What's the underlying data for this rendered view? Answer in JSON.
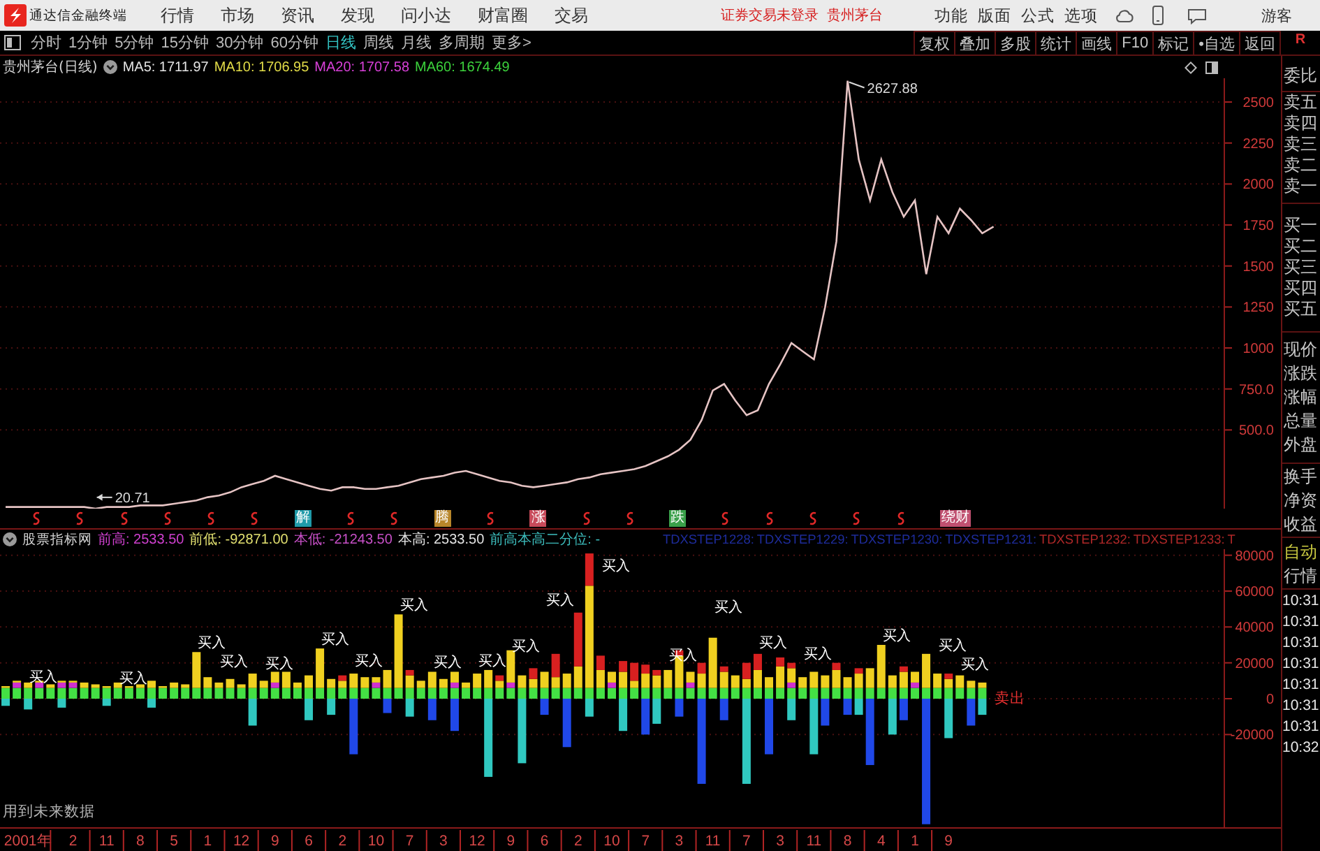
{
  "title_bar": {
    "app_name": "通达信金融终端",
    "menu": [
      "行情",
      "市场",
      "资讯",
      "发现",
      "问小达",
      "财富圈",
      "交易"
    ],
    "status": "证券交易未登录",
    "stock": "贵州茅台",
    "tools": [
      "功能",
      "版面",
      "公式",
      "选项"
    ],
    "user": "游客"
  },
  "toolbar": {
    "periods": [
      {
        "label": "分时",
        "selected": false
      },
      {
        "label": "1分钟",
        "selected": false
      },
      {
        "label": "5分钟",
        "selected": false
      },
      {
        "label": "15分钟",
        "selected": false
      },
      {
        "label": "30分钟",
        "selected": false
      },
      {
        "label": "60分钟",
        "selected": false
      },
      {
        "label": "日线",
        "selected": true
      },
      {
        "label": "周线",
        "selected": false
      },
      {
        "label": "月线",
        "selected": false
      },
      {
        "label": "多周期",
        "selected": false
      },
      {
        "label": "更多>",
        "selected": false
      }
    ],
    "actions": [
      "复权",
      "叠加",
      "多股",
      "统计",
      "画线",
      "F10",
      "标记",
      "•自选",
      "返回"
    ],
    "corner": "R"
  },
  "price_panel": {
    "title": "贵州茅台(日线)",
    "ma": [
      {
        "text": "MA5: 1711.97",
        "color": "#e4e4e4"
      },
      {
        "text": "MA10: 1706.95",
        "color": "#e2dc48"
      },
      {
        "text": "MA20: 1707.58",
        "color": "#d840d8"
      },
      {
        "text": "MA60: 1674.49",
        "color": "#3cd23c"
      }
    ],
    "chart_data": {
      "type": "line",
      "series": [
        {
          "color": "#e6c4c4",
          "values": [
            30,
            30,
            30,
            30,
            30,
            30,
            30,
            30,
            20,
            30,
            30,
            30,
            40,
            40,
            40,
            50,
            60,
            70,
            90,
            100,
            120,
            150,
            170,
            190,
            220,
            200,
            180,
            160,
            140,
            130,
            150,
            150,
            140,
            140,
            150,
            160,
            180,
            200,
            210,
            220,
            240,
            250,
            230,
            210,
            190,
            180,
            160,
            150,
            160,
            170,
            180,
            200,
            210,
            230,
            240,
            250,
            260,
            280,
            310,
            340,
            380,
            440,
            560,
            740,
            780,
            680,
            590,
            620,
            780,
            900,
            1030,
            980,
            930,
            1250,
            1650,
            2630,
            2150,
            1900,
            2150,
            1950,
            1800,
            1900,
            1450,
            1800,
            1700,
            1850,
            1780,
            1700,
            1740
          ]
        }
      ],
      "ylim": [
        20,
        2645
      ],
      "grid": true,
      "yticks": [
        {
          "value": 2500,
          "label": "2500"
        },
        {
          "value": 2250,
          "label": "2250"
        },
        {
          "value": 2000,
          "label": "2000"
        },
        {
          "value": 1750,
          "label": "1750"
        },
        {
          "value": 1500,
          "label": "1500"
        },
        {
          "value": 1250,
          "label": "1250"
        },
        {
          "value": 1000,
          "label": "1000"
        },
        {
          "value": 750,
          "label": "750.0"
        },
        {
          "value": 500,
          "label": "500.0"
        }
      ],
      "annotations": [
        "2627.88",
        {
          "text": "20.71",
          "y": 20.71
        }
      ]
    },
    "event_markers": [
      {
        "kind": "mark"
      },
      {
        "kind": "mark"
      },
      {
        "kind": "mark"
      },
      {
        "kind": "mark"
      },
      {
        "kind": "mark"
      },
      {
        "kind": "mark"
      },
      {
        "kind": "tag",
        "text": "解",
        "color": "#1f9aa8"
      },
      {
        "kind": "mark"
      },
      {
        "kind": "mark"
      },
      {
        "kind": "tag",
        "text": "腾",
        "color": "#b8862a"
      },
      {
        "kind": "mark"
      },
      {
        "kind": "tag",
        "text": "涨",
        "color": "#c84a5a"
      },
      {
        "kind": "mark"
      },
      {
        "kind": "mark"
      },
      {
        "kind": "tag",
        "text": "跌",
        "color": "#3aa04a"
      },
      {
        "kind": "mark"
      },
      {
        "kind": "mark"
      },
      {
        "kind": "mark"
      },
      {
        "kind": "mark"
      },
      {
        "kind": "mark"
      },
      {
        "kind": "tag",
        "text": "绕财",
        "color": "#c05070"
      }
    ]
  },
  "indicator_panel": {
    "title": "股票指标网",
    "values": [
      {
        "text": "前高: 2533.50",
        "color": "#d040d0"
      },
      {
        "text": "前低: -92871.00",
        "color": "#e2e070"
      },
      {
        "text": "本低: -21243.50",
        "color": "#c850c8"
      },
      {
        "text": "本高: 2533.50",
        "color": "#e4e4e4"
      },
      {
        "text": "前高本高二分位: -",
        "color": "#3cbcbc"
      }
    ],
    "steps": [
      {
        "text": "TDXSTEP1228:",
        "color": "#1e2c9c"
      },
      {
        "text": "TDXSTEP1229:",
        "color": "#1e2c9c"
      },
      {
        "text": "TDXSTEP1230:",
        "color": "#1e2c9c"
      },
      {
        "text": "TDXSTEP1231:",
        "color": "#1e2c9c"
      },
      {
        "text": "TDXSTEP1232:",
        "color": "#b02828"
      },
      {
        "text": "TDXSTEP1233:",
        "color": "#b02828"
      },
      {
        "text": "T",
        "color": "#b02828"
      }
    ],
    "chart_data": {
      "type": "bar",
      "stacked": true,
      "grid": true,
      "categories": [
        null,
        null,
        "2001年",
        null,
        null,
        null,
        "2",
        null,
        null,
        "11",
        null,
        null,
        "8",
        null,
        null,
        "5",
        null,
        null,
        "1",
        null,
        null,
        "12",
        null,
        null,
        "9",
        null,
        null,
        "6",
        null,
        null,
        "2",
        null,
        null,
        "10",
        null,
        null,
        "7",
        null,
        null,
        "3",
        null,
        null,
        "12",
        null,
        null,
        "9",
        null,
        null,
        "6",
        null,
        null,
        "2",
        null,
        null,
        "10",
        null,
        null,
        "7",
        null,
        null,
        "3",
        null,
        null,
        "11",
        null,
        null,
        "7",
        null,
        null,
        "3",
        null,
        null,
        "11",
        null,
        null,
        "8",
        null,
        null,
        "4",
        null,
        null,
        "1",
        null,
        null,
        "9",
        null,
        null,
        null,
        null,
        null,
        null,
        null,
        null,
        null,
        null,
        null,
        null,
        null,
        null,
        null,
        null,
        null,
        null,
        null,
        null,
        null,
        null,
        null,
        null
      ],
      "ylim": [
        -71690,
        83380
      ],
      "yticks": [
        {
          "value": 80000,
          "label": "80000"
        },
        {
          "value": 60000,
          "label": "60000"
        },
        {
          "value": 40000,
          "label": "40000"
        },
        {
          "value": 20000,
          "label": "20000"
        },
        {
          "value": 0,
          "label": "0"
        },
        {
          "value": -20000,
          "label": "-20000"
        }
      ],
      "series": [
        {
          "color": "#44e044",
          "values": [
            6000,
            6000,
            6000,
            6000,
            6000,
            6000,
            6000,
            6000,
            6000,
            6000,
            6000,
            6000,
            6000,
            6000,
            6000,
            6000,
            6000,
            6000,
            6000,
            6000,
            6000,
            6000,
            6000,
            6000,
            6000,
            6000,
            6000,
            6000,
            6000,
            6000,
            6000,
            6000,
            6000,
            6000,
            6000,
            6000,
            6000,
            6000,
            6000,
            6000,
            6000,
            6000,
            6000,
            6000,
            6000,
            6000,
            6000,
            6000,
            6000,
            6000,
            6000,
            6000,
            6000,
            6000,
            6000,
            6000,
            6000,
            6000,
            6000,
            6000,
            6000,
            6000,
            6000,
            6000,
            6000,
            6000,
            6000,
            6000,
            6000,
            6000,
            6000,
            6000,
            6000,
            6000,
            6000,
            6000,
            6000,
            6000,
            6000,
            6000,
            6000,
            6000,
            6000,
            6000,
            6000,
            6000,
            6000,
            6000,
            null,
            null,
            null,
            null,
            null,
            null,
            null,
            null,
            null,
            null,
            null,
            null,
            null,
            null,
            null,
            null,
            null,
            null,
            null,
            null,
            null
          ]
        },
        {
          "color": "#d030d0",
          "values": [
            null,
            3000,
            null,
            3000,
            null,
            3000,
            3000,
            null,
            null,
            null,
            null,
            null,
            null,
            null,
            null,
            null,
            null,
            null,
            null,
            null,
            null,
            null,
            null,
            null,
            3000,
            null,
            null,
            null,
            null,
            null,
            null,
            null,
            null,
            3000,
            null,
            null,
            null,
            null,
            null,
            null,
            3000,
            null,
            null,
            null,
            null,
            3000,
            null,
            null,
            null,
            null,
            null,
            null,
            null,
            null,
            3000,
            null,
            null,
            null,
            null,
            null,
            null,
            3000,
            null,
            null,
            null,
            null,
            null,
            null,
            null,
            null,
            3000,
            null,
            null,
            null,
            null,
            null,
            null,
            null,
            null,
            null,
            null,
            3000,
            null,
            null,
            null,
            null,
            null,
            null,
            null,
            null,
            null,
            null,
            null,
            null,
            null,
            null,
            null,
            null,
            null,
            null,
            null,
            null,
            null,
            null,
            null,
            null,
            null,
            null,
            null
          ]
        },
        {
          "color": "#f0d020",
          "values": [
            1000,
            1000,
            3000,
            1000,
            2000,
            1000,
            1000,
            3000,
            2000,
            1000,
            3000,
            1000,
            2000,
            4000,
            1000,
            3000,
            2000,
            20000,
            6000,
            3000,
            5000,
            2000,
            8000,
            4000,
            6000,
            9000,
            3000,
            7000,
            22000,
            5000,
            4000,
            8000,
            6000,
            3000,
            10000,
            41000,
            7000,
            4000,
            9000,
            5000,
            6000,
            3000,
            8000,
            10000,
            4000,
            18000,
            7000,
            5000,
            9000,
            6000,
            8000,
            12000,
            57000,
            10000,
            6000,
            9000,
            4000,
            8000,
            7000,
            10000,
            18000,
            6000,
            8000,
            28000,
            9000,
            7000,
            5000,
            10000,
            6000,
            12000,
            8000,
            6000,
            9000,
            7000,
            10000,
            6000,
            8000,
            11000,
            24000,
            7000,
            9000,
            6000,
            19000,
            8000,
            5000,
            7000,
            4000,
            3000,
            null,
            null,
            null,
            null,
            null,
            null,
            null,
            null,
            null,
            null,
            null,
            null,
            null,
            null,
            null,
            null,
            null,
            null,
            null,
            null,
            null
          ]
        },
        {
          "color": "#d82020",
          "values": [
            null,
            null,
            null,
            null,
            null,
            null,
            null,
            null,
            null,
            null,
            null,
            null,
            null,
            null,
            null,
            null,
            null,
            null,
            null,
            null,
            null,
            null,
            null,
            null,
            null,
            null,
            null,
            null,
            null,
            null,
            3000,
            null,
            null,
            null,
            null,
            null,
            3000,
            null,
            null,
            null,
            null,
            null,
            null,
            null,
            3000,
            null,
            null,
            6000,
            null,
            13000,
            null,
            30000,
            18000,
            8000,
            null,
            6000,
            10000,
            5000,
            3000,
            null,
            3000,
            null,
            6000,
            null,
            3000,
            null,
            9000,
            9000,
            null,
            5000,
            3000,
            null,
            null,
            null,
            4000,
            null,
            3000,
            null,
            null,
            null,
            3000,
            null,
            null,
            null,
            3000,
            null,
            null,
            null,
            null,
            null,
            null,
            null,
            null,
            null,
            null,
            null,
            null,
            null,
            null,
            null,
            null,
            null,
            null,
            null,
            null,
            null,
            null,
            null,
            null
          ]
        },
        {
          "color": "#2048e8",
          "values": [
            null,
            null,
            null,
            null,
            null,
            null,
            null,
            null,
            null,
            null,
            null,
            null,
            null,
            null,
            null,
            null,
            null,
            null,
            null,
            null,
            null,
            null,
            null,
            null,
            null,
            null,
            null,
            null,
            null,
            null,
            null,
            -31000,
            null,
            null,
            -8000,
            null,
            null,
            null,
            -12000,
            null,
            -18000,
            null,
            null,
            null,
            null,
            null,
            null,
            null,
            -9000,
            null,
            -27000,
            null,
            null,
            null,
            null,
            null,
            null,
            -20000,
            null,
            null,
            -10000,
            null,
            -47500,
            null,
            -12000,
            null,
            null,
            null,
            -31000,
            null,
            null,
            null,
            null,
            -15000,
            null,
            -9000,
            null,
            -37000,
            null,
            null,
            -12000,
            null,
            -70000,
            null,
            null,
            null,
            -15000,
            null,
            null,
            null,
            null,
            null,
            null,
            null,
            null,
            null,
            null,
            null,
            null,
            null,
            null,
            null,
            null,
            null,
            null,
            null,
            null,
            null,
            null
          ]
        },
        {
          "color": "#30c8c0",
          "values": [
            -4000,
            null,
            -6000,
            null,
            null,
            -5000,
            null,
            null,
            null,
            -4000,
            null,
            null,
            null,
            -5000,
            null,
            null,
            null,
            null,
            null,
            null,
            null,
            null,
            -15000,
            null,
            null,
            null,
            null,
            -12000,
            null,
            -9000,
            null,
            null,
            null,
            null,
            null,
            null,
            -10000,
            null,
            null,
            null,
            null,
            null,
            null,
            -43600,
            null,
            null,
            -36000,
            null,
            null,
            null,
            null,
            null,
            -10000,
            null,
            null,
            -18000,
            null,
            null,
            -14000,
            null,
            null,
            null,
            null,
            null,
            null,
            null,
            -47500,
            null,
            null,
            null,
            -12000,
            null,
            -31000,
            null,
            null,
            null,
            -9000,
            null,
            null,
            -20000,
            null,
            null,
            null,
            null,
            -22000,
            null,
            null,
            -9000,
            null,
            null,
            null,
            null,
            null,
            null,
            null,
            null,
            null,
            null,
            null,
            null,
            null,
            null,
            null,
            null,
            null,
            null,
            null,
            null,
            null
          ]
        }
      ],
      "annotations": [
        "买入",
        "买入",
        "买入",
        "买入",
        "买入",
        "买入",
        "买入",
        "买入",
        "买入",
        "买入",
        "买入",
        "买入",
        "买入",
        "买入",
        "买入",
        "买入",
        "买入",
        "买入",
        "买入",
        "买入"
      ]
    },
    "sell_label": "卖出",
    "note": "用到未来数据"
  },
  "sidebar": {
    "groups": [
      [
        "委比"
      ],
      [
        "卖五",
        "卖四",
        "卖三",
        "卖二",
        "卖一"
      ],
      [
        "买一",
        "买二",
        "买三",
        "买四",
        "买五"
      ],
      [
        "现价",
        "涨跌",
        "涨幅",
        "总量",
        "外盘"
      ],
      [
        "换手",
        "净资",
        "收益"
      ]
    ],
    "auto": "自动",
    "ticks_title": "行情",
    "times": [
      "10:31",
      "10:31",
      "10:31",
      "10:31",
      "10:31",
      "10:31",
      "10:31",
      "10:32"
    ]
  }
}
